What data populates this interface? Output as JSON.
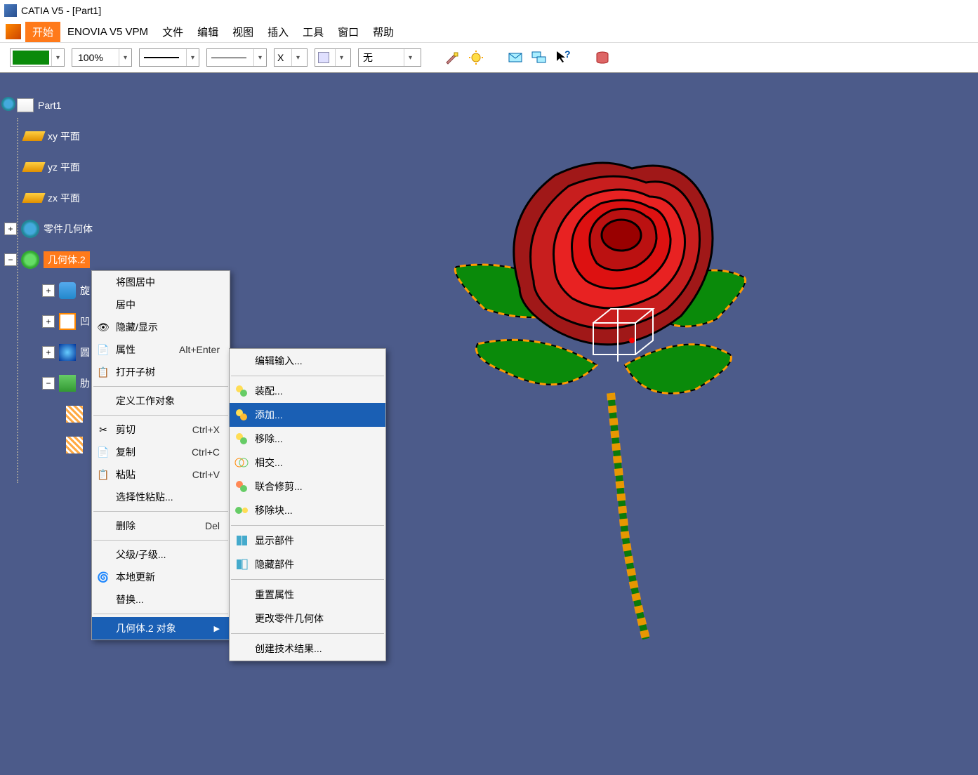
{
  "title": "CATIA V5 - [Part1]",
  "menubar": {
    "start": "开始",
    "enovia": "ENOVIA V5 VPM",
    "file": "文件",
    "edit": "编辑",
    "view": "视图",
    "insert": "插入",
    "tool": "工具",
    "window": "窗口",
    "help": "帮助"
  },
  "toolbar": {
    "zoom": "100%",
    "none": "无",
    "x": "X"
  },
  "tree": {
    "root": "Part1",
    "xy": "xy 平面",
    "yz": "yz 平面",
    "zx": "zx 平面",
    "partbody": "零件几何体",
    "body2": "几何体.2",
    "c1": "旋",
    "c2": "凹",
    "c3": "圆",
    "c4": "肋"
  },
  "context": {
    "center_graph": "将图居中",
    "center": "居中",
    "hide_show": "隐藏/显示",
    "properties": "属性",
    "prop_sc": "Alt+Enter",
    "open_subtree": "打开子树",
    "define_work": "定义工作对象",
    "cut": "剪切",
    "cut_sc": "Ctrl+X",
    "copy": "复制",
    "copy_sc": "Ctrl+C",
    "paste": "粘贴",
    "paste_sc": "Ctrl+V",
    "paste_special": "选择性粘贴...",
    "delete": "删除",
    "delete_sc": "Del",
    "parent_child": "父级/子级...",
    "local_update": "本地更新",
    "replace": "替换...",
    "object": "几何体.2 对象"
  },
  "submenu": {
    "edit_input": "编辑输入...",
    "assemble": "装配...",
    "add": "添加...",
    "remove": "移除...",
    "intersect": "相交...",
    "union_trim": "联合修剪...",
    "remove_lump": "移除块...",
    "show_comp": "显示部件",
    "hide_comp": "隐藏部件",
    "reset_prop": "重置属性",
    "change_body": "更改零件几何体",
    "create_tech": "创建技术结果..."
  }
}
